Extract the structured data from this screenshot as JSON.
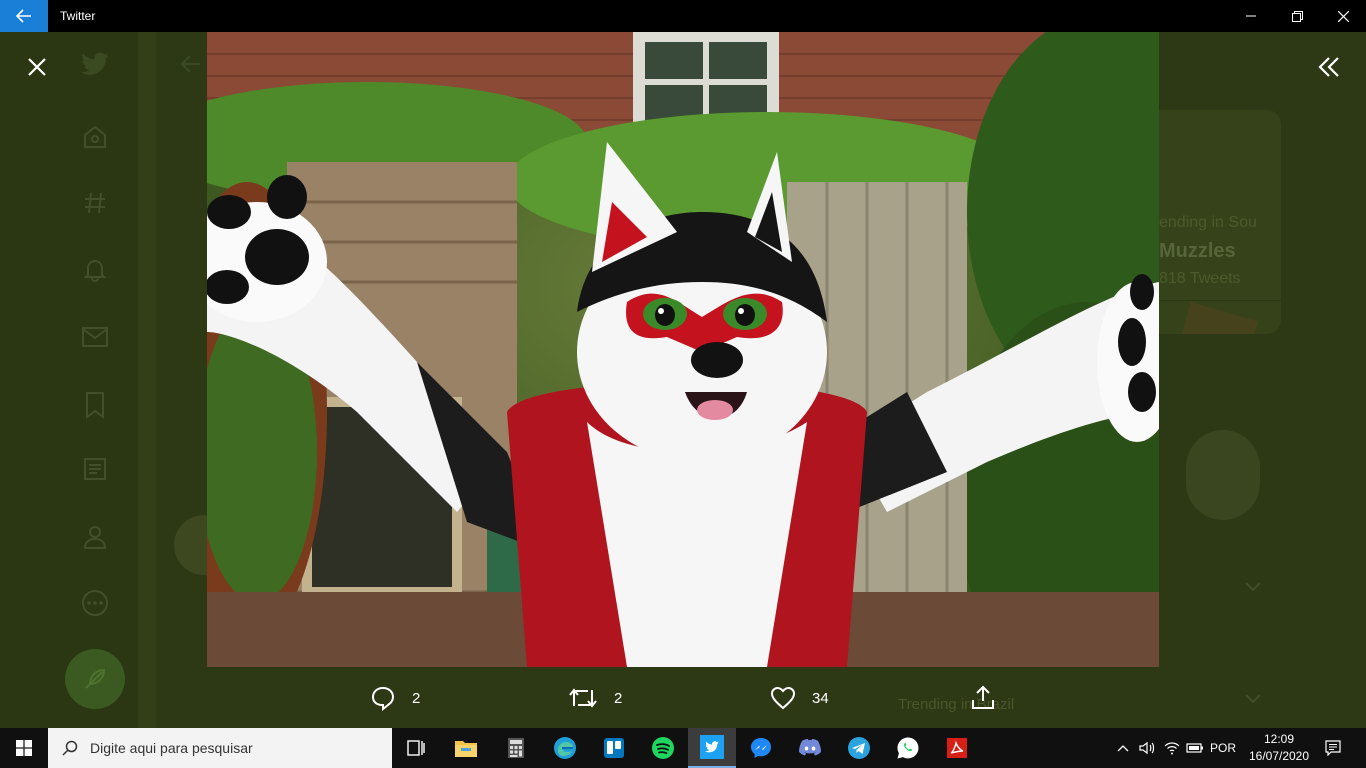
{
  "window": {
    "title": "Twitter"
  },
  "background_page": {
    "trend_subtitle": "ending in Sou",
    "trend_tag": "Muzzles",
    "trend_count": "818 Tweets",
    "trend_bottom": "Trending in Brazil"
  },
  "viewer": {
    "actions": {
      "reply_count": "2",
      "retweet_count": "2",
      "like_count": "34"
    }
  },
  "taskbar": {
    "search_placeholder": "Digite aqui para pesquisar",
    "apps": [
      "task-view",
      "file-explorer",
      "calculator",
      "edge",
      "trello",
      "spotify",
      "twitter",
      "messenger",
      "discord",
      "telegram",
      "whatsapp",
      "acrobat-reader"
    ],
    "language": "POR",
    "time": "12:09",
    "date": "16/07/2020"
  },
  "colors": {
    "accent_blue": "#1a7fd6",
    "dim_overlay": "#2d3815",
    "taskbar_bg": "#101010"
  }
}
